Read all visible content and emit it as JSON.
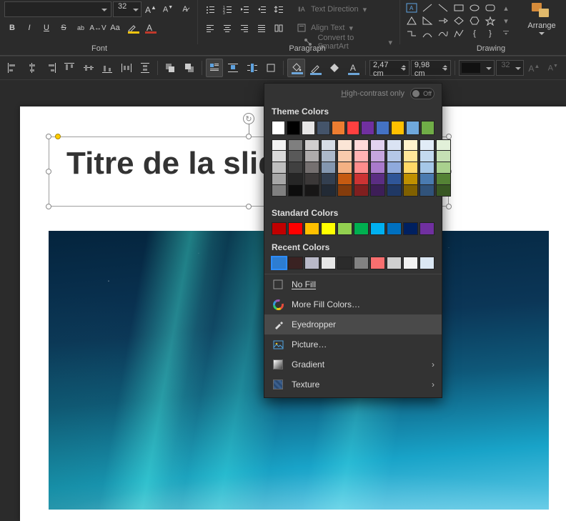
{
  "ribbon": {
    "groups": {
      "font": "Font",
      "paragraph": "Paragraph",
      "drawing": "Drawing"
    },
    "font": {
      "family": "",
      "size": "32",
      "bold": "B",
      "italic": "I",
      "underline": "U",
      "strike": "S",
      "case_label": "Aa"
    },
    "paragraph": {
      "text_direction": "Text Direction",
      "align_text": "Align Text",
      "convert_smartart": "Convert to SmartArt"
    },
    "drawing": {
      "arrange": "Arrange"
    }
  },
  "toolbar2": {
    "height": "2,47 cm",
    "width": "9,98 cm",
    "font_size_disabled": "32"
  },
  "slide": {
    "title": "Titre de la slide"
  },
  "color_picker": {
    "high_contrast": "High-contrast only",
    "toggle_state": "Off",
    "theme_heading": "Theme Colors",
    "standard_heading": "Standard Colors",
    "recent_heading": "Recent Colors",
    "theme_main": [
      "#ffffff",
      "#000000",
      "#e7e6e6",
      "#44546a",
      "#ed7d31",
      "#ff4040",
      "#7030a0",
      "#4472c4",
      "#ffc000",
      "#6fa8dc",
      "#70ad47"
    ],
    "theme_tints": [
      [
        "#f2f2f2",
        "#d9d9d9",
        "#bfbfbf",
        "#a6a6a6",
        "#808080"
      ],
      [
        "#7f7f7f",
        "#595959",
        "#404040",
        "#262626",
        "#0d0d0d"
      ],
      [
        "#d0cece",
        "#aeabab",
        "#757070",
        "#3b3838",
        "#171616"
      ],
      [
        "#d6dce5",
        "#adb9ca",
        "#8497b0",
        "#333f50",
        "#222a35"
      ],
      [
        "#fbe5d6",
        "#f8cbad",
        "#f4b183",
        "#c55a11",
        "#843c0c"
      ],
      [
        "#ffd9d9",
        "#ffb3b3",
        "#ff8c8c",
        "#cc3333",
        "#801f1f"
      ],
      [
        "#e2d2ef",
        "#c6a6de",
        "#a97acb",
        "#5b2d83",
        "#3d1e57"
      ],
      [
        "#dae3f3",
        "#b4c7e7",
        "#8faadc",
        "#2f5597",
        "#203864"
      ],
      [
        "#fff2cc",
        "#ffe699",
        "#ffd966",
        "#bf9000",
        "#806000"
      ],
      [
        "#e1ecf7",
        "#c3daef",
        "#a5c7e7",
        "#4a7bb0",
        "#31537a"
      ],
      [
        "#e2f0d9",
        "#c5e0b4",
        "#a9d18e",
        "#548235",
        "#385723"
      ]
    ],
    "standard": [
      "#c00000",
      "#ff0000",
      "#ffc000",
      "#ffff00",
      "#92d050",
      "#00b050",
      "#00b0f0",
      "#0070c0",
      "#002060",
      "#7030a0"
    ],
    "recent": [
      "#2d7dd2",
      "#3a2222",
      "#b9b9c8",
      "#e6e6e6",
      "#2b2b2b",
      "#828282",
      "#f96f6f",
      "#cfcfcf",
      "#f2f2f2",
      "#dbe7f3"
    ],
    "menu": {
      "no_fill": "No Fill",
      "more": "More Fill Colors…",
      "eyedropper": "Eyedropper",
      "picture": "Picture…",
      "gradient": "Gradient",
      "texture": "Texture"
    }
  }
}
